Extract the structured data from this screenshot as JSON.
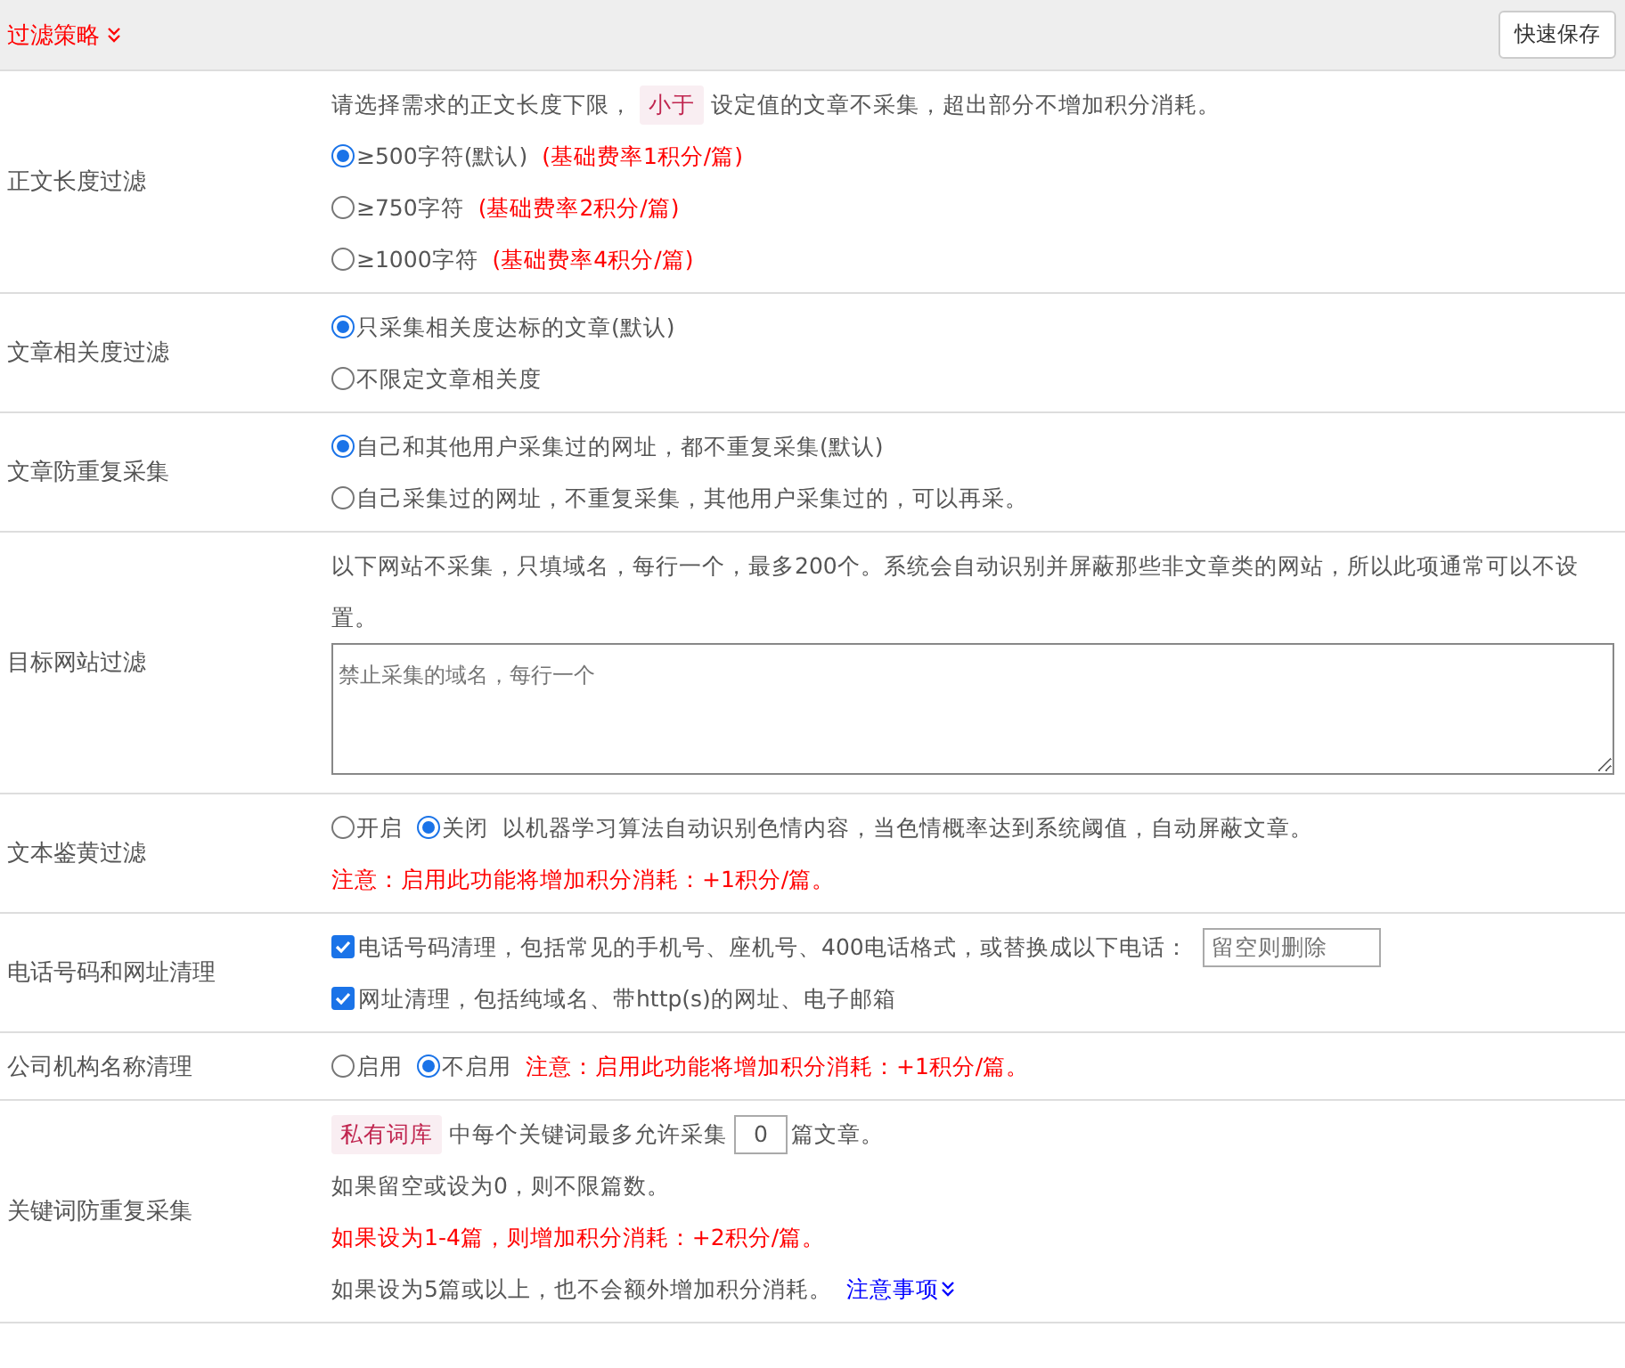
{
  "header": {
    "title": "过滤策略",
    "save_button": "快速保存"
  },
  "rows": [
    {
      "label": "正文长度过滤",
      "lines": [
        {
          "parts": [
            {
              "kind": "text",
              "text": "请选择需求的正文长度下限，"
            },
            {
              "kind": "tag",
              "text": "小于"
            },
            {
              "kind": "text",
              "text": "设定值的文章不采集，超出部分不增加积分消耗。"
            }
          ]
        },
        {
          "parts": [
            {
              "kind": "radio",
              "label": "≥500字符(默认)",
              "selected": true
            },
            {
              "kind": "warn",
              "text": "(基础费率1积分/篇)"
            }
          ]
        },
        {
          "parts": [
            {
              "kind": "radio",
              "label": "≥750字符",
              "selected": false
            },
            {
              "kind": "warn",
              "text": "(基础费率2积分/篇)"
            }
          ]
        },
        {
          "parts": [
            {
              "kind": "radio",
              "label": "≥1000字符",
              "selected": false
            },
            {
              "kind": "warn",
              "text": "(基础费率4积分/篇)"
            }
          ]
        }
      ]
    },
    {
      "label": "文章相关度过滤",
      "lines": [
        {
          "parts": [
            {
              "kind": "radio",
              "label": "只采集相关度达标的文章(默认)",
              "selected": true
            }
          ]
        },
        {
          "parts": [
            {
              "kind": "radio",
              "label": "不限定文章相关度",
              "selected": false
            }
          ]
        }
      ]
    },
    {
      "label": "文章防重复采集",
      "lines": [
        {
          "parts": [
            {
              "kind": "radio",
              "label": "自己和其他用户采集过的网址，都不重复采集(默认)",
              "selected": true
            }
          ]
        },
        {
          "parts": [
            {
              "kind": "radio",
              "label": "自己采集过的网址，不重复采集，其他用户采集过的，可以再采。",
              "selected": false
            }
          ]
        }
      ]
    },
    {
      "label": "目标网站过滤",
      "lines": [
        {
          "parts": [
            {
              "kind": "text",
              "text": "以下网站不采集，只填域名，每行一个，最多200个。系统会自动识别并屏蔽那些非文章类的网站，所以此项通常可以不设置。"
            }
          ]
        },
        {
          "parts": [
            {
              "kind": "textarea",
              "placeholder": "禁止采集的域名，每行一个"
            }
          ]
        }
      ]
    },
    {
      "label": "文本鉴黄过滤",
      "lines": [
        {
          "parts": [
            {
              "kind": "radio",
              "label": "开启",
              "selected": false
            },
            {
              "kind": "radio",
              "label": "关闭",
              "selected": true
            },
            {
              "kind": "text",
              "text": "以机器学习算法自动识别色情内容，当色情概率达到系统阈值，自动屏蔽文章。"
            }
          ]
        },
        {
          "parts": [
            {
              "kind": "warn",
              "text": "注意：启用此功能将增加积分消耗：+1积分/篇。"
            }
          ]
        }
      ]
    },
    {
      "label": "电话号码和网址清理",
      "lines": [
        {
          "parts": [
            {
              "kind": "checkbox",
              "label": "电话号码清理，包括常见的手机号、座机号、400电话格式，或替换成以下电话：",
              "checked": true
            },
            {
              "kind": "input",
              "placeholder": "留空则删除"
            }
          ]
        },
        {
          "parts": [
            {
              "kind": "checkbox",
              "label": "网址清理，包括纯域名、带http(s)的网址、电子邮箱",
              "checked": true
            }
          ]
        }
      ]
    },
    {
      "label": "公司机构名称清理",
      "lines": [
        {
          "parts": [
            {
              "kind": "radio",
              "label": "启用",
              "selected": false
            },
            {
              "kind": "radio",
              "label": "不启用",
              "selected": true
            },
            {
              "kind": "warn",
              "text": "注意：启用此功能将增加积分消耗：+1积分/篇。"
            }
          ]
        }
      ]
    },
    {
      "label": "关键词防重复采集",
      "lines": [
        {
          "parts": [
            {
              "kind": "tag",
              "text": "私有词库"
            },
            {
              "kind": "text",
              "text": "中每个关键词最多允许采集"
            },
            {
              "kind": "input",
              "value": "0"
            },
            {
              "kind": "text",
              "text": "篇文章。"
            }
          ]
        },
        {
          "parts": [
            {
              "kind": "text",
              "text": "如果留空或设为0，则不限篇数。"
            }
          ]
        },
        {
          "parts": [
            {
              "kind": "warn",
              "text": "如果设为1-4篇，则增加积分消耗：+2积分/篇。"
            }
          ]
        },
        {
          "parts": [
            {
              "kind": "text",
              "text": "如果设为5篇或以上，也不会额外增加积分消耗。"
            },
            {
              "kind": "link",
              "text": "注意事项"
            }
          ]
        }
      ]
    }
  ]
}
